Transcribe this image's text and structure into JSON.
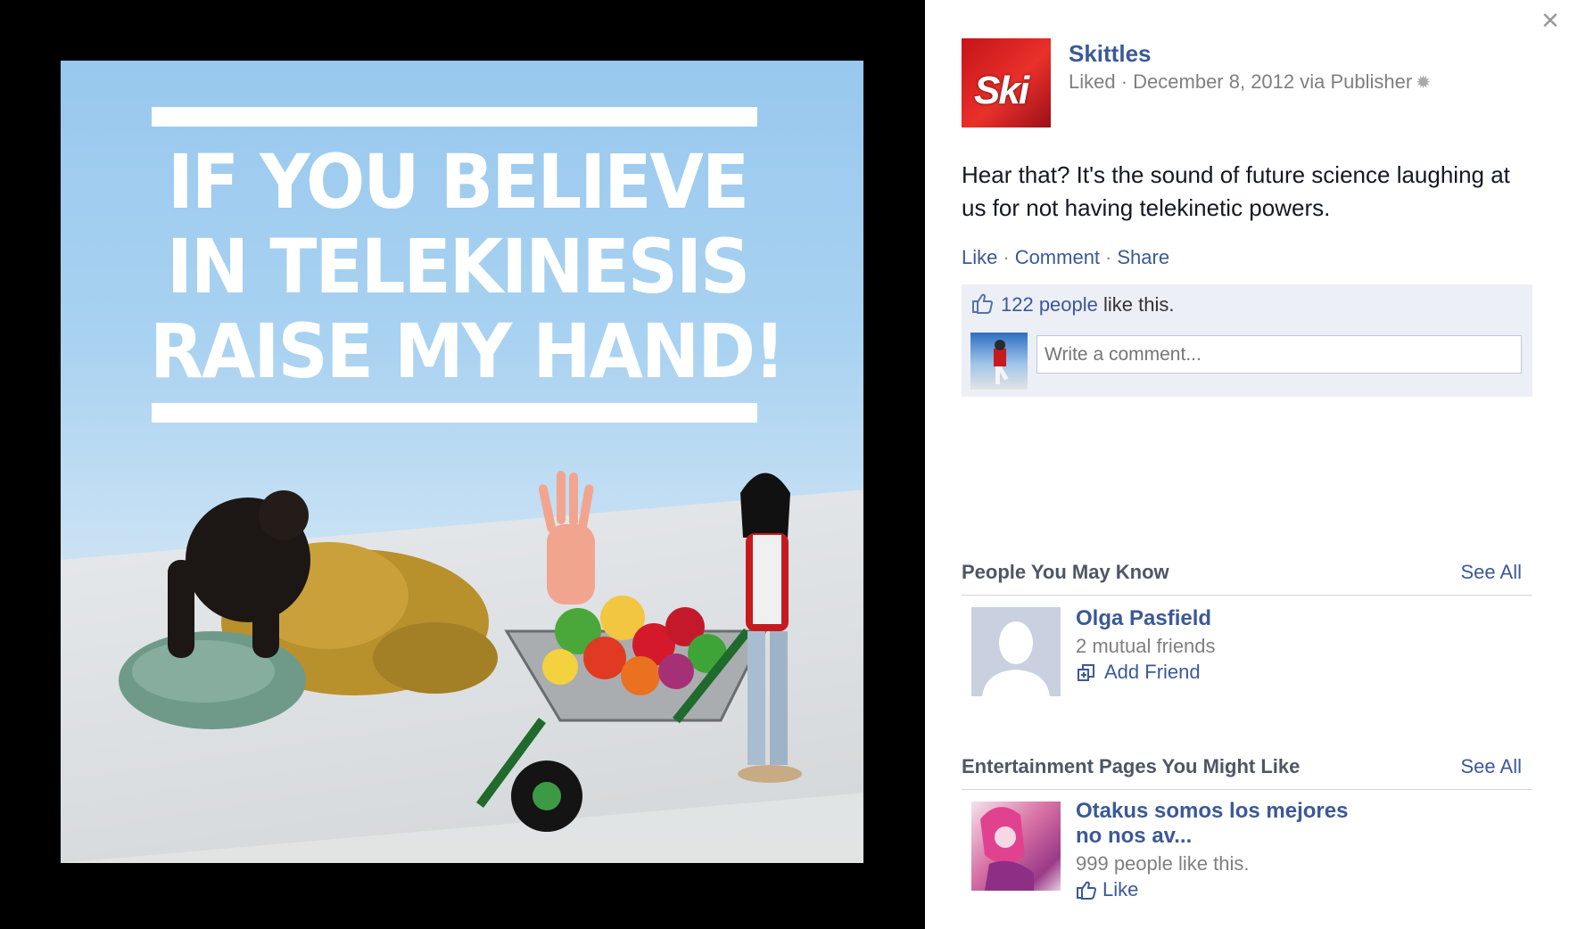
{
  "photo": {
    "headline_lines": [
      "IF YOU BELIEVE",
      "IN TELEKINESIS",
      "RAISE MY HAND!"
    ]
  },
  "post": {
    "page_name": "Skittles",
    "avatar_text": "Ski",
    "meta": "Liked · December 8, 2012 via Publisher",
    "text": "Hear that? It's the sound of future science laughing at us for not having telekinetic powers.",
    "actions": {
      "like": "Like",
      "comment": "Comment",
      "share": "Share"
    },
    "likes": {
      "count_link": "122 people",
      "suffix": " like this."
    },
    "comment_placeholder": "Write a comment..."
  },
  "people_you_may_know": {
    "title": "People You May Know",
    "see_all": "See All",
    "person": {
      "name": "Olga Pasfield",
      "mutual": "2 mutual friends",
      "action": "Add Friend"
    }
  },
  "entertainment_pages": {
    "title": "Entertainment Pages You Might Like",
    "see_all": "See All",
    "page": {
      "name_line1": "Otakus somos los mejores",
      "name_line2": "no nos av...",
      "likes": "999 people like this.",
      "action": "Like"
    }
  },
  "colors": {
    "link": "#3b5998",
    "muted": "#7f7f7f",
    "ufi_bg": "#eceff5",
    "photo_pane": "#000000"
  },
  "icons": [
    "close-icon",
    "gear-icon",
    "thumbs-up-icon",
    "add-friend-icon",
    "like-thumb-icon"
  ]
}
